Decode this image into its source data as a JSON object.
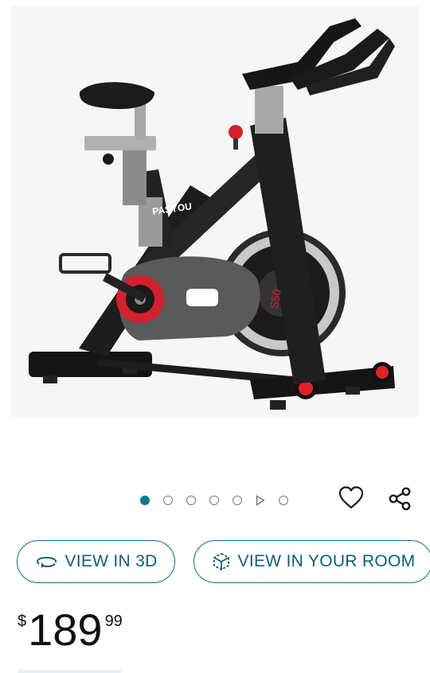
{
  "product": {
    "brand_logo": "PASYOU",
    "frame_label": "S50"
  },
  "gallery": {
    "image_count": 6,
    "active_index": 0,
    "has_video": true
  },
  "actions": {
    "view_3d_label": "VIEW IN 3D",
    "view_room_label": "VIEW IN YOUR ROOM"
  },
  "price": {
    "symbol": "$",
    "whole": "189",
    "fraction": "99"
  },
  "colors": {
    "accent": "#0d6e8a",
    "active_dot": "#0b7a8a",
    "bike_red": "#e0202a"
  }
}
